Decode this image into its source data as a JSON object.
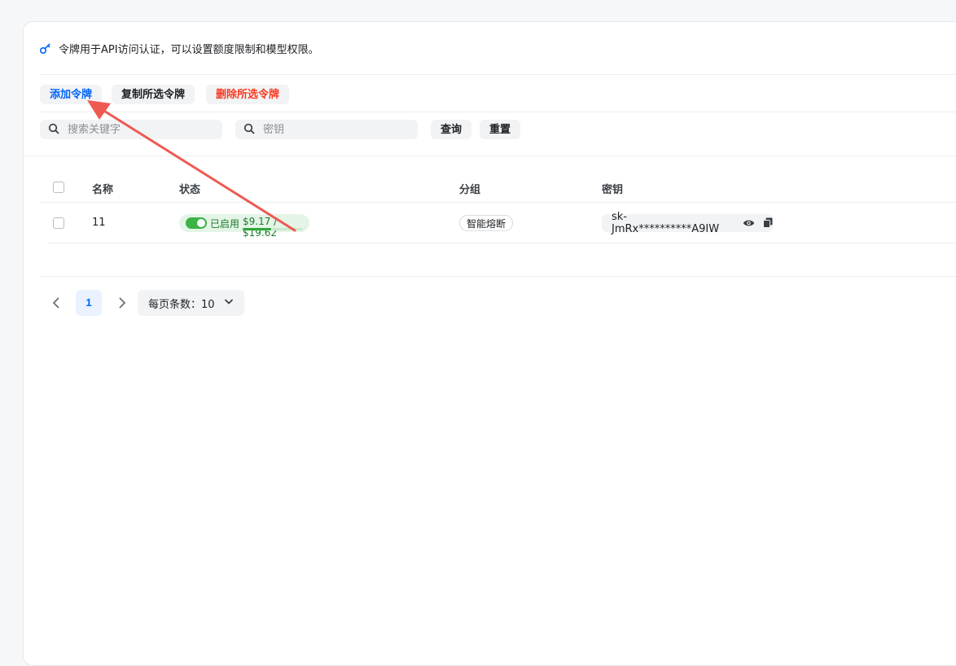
{
  "intro": {
    "text": "令牌用于API访问认证，可以设置额度限制和模型权限。",
    "icon": "key-icon"
  },
  "toolbar": {
    "add_label": "添加令牌",
    "copy_label": "复制所选令牌",
    "delete_label": "删除所选令牌"
  },
  "filters": {
    "keyword_placeholder": "搜索关键字",
    "key_placeholder": "密钥",
    "query_label": "查询",
    "reset_label": "重置"
  },
  "table": {
    "columns": [
      "名称",
      "状态",
      "分组",
      "密钥"
    ],
    "rows": [
      {
        "name": "11",
        "status": "已启用",
        "quota": "$9.17 / $19.62",
        "quota_fraction": 0.47,
        "group": "智能熔断",
        "key": "sk-JmRx**********A9IW"
      }
    ]
  },
  "pagination": {
    "current_page": "1",
    "page_size_label": "每页条数：10"
  },
  "colors": {
    "accent": "#0064fa",
    "danger": "#f93920",
    "success": "#3bb346",
    "annotation_arrow": "#ee5a52"
  }
}
